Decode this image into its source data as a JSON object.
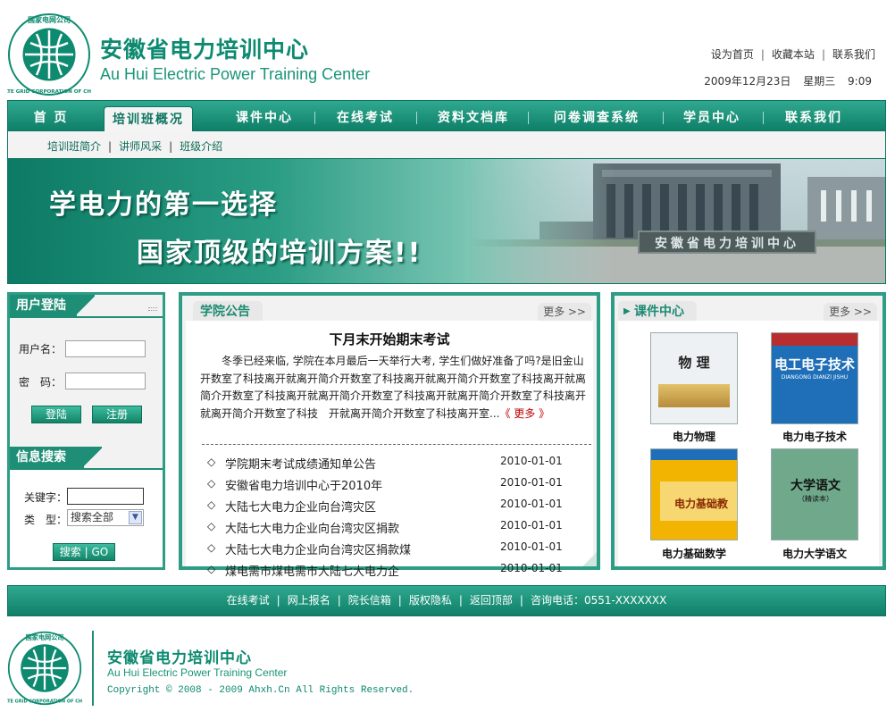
{
  "header": {
    "logo_ring_text": "STATE GRID CORPORATION OF CHINA · 国家电网公司",
    "title_cn": "安徽省电力培训中心",
    "title_en": "Au Hui Electric Power Training Center",
    "links": [
      "设为首页",
      "收藏本站",
      "联系我们"
    ],
    "date": "2009年12月23日",
    "weekday": "星期三",
    "time": "9:09"
  },
  "nav": {
    "items": [
      "首 页",
      "培训班概况",
      "课件中心",
      "在线考试",
      "资料文档库",
      "问卷调查系统",
      "学员中心",
      "联系我们"
    ],
    "active_index": 1
  },
  "subnav": [
    "培训班简介",
    "讲师风采",
    "班级介绍"
  ],
  "banner": {
    "line1": "学电力的第一选择",
    "line2": "国家顶级的培训方案!!",
    "sign": "安徽省电力培训中心"
  },
  "login": {
    "title": "用户登陆",
    "username_label": "用户名：",
    "password_label": "密　码：",
    "username_value": "",
    "password_value": "",
    "login_button": "登陆",
    "register_button": "注册"
  },
  "search": {
    "title": "信息搜索",
    "keyword_label": "关键字：",
    "keyword_value": "",
    "type_label": "类　型：",
    "type_selected": "搜索全部",
    "search_button": "搜索 | GO"
  },
  "notice": {
    "tab": "学院公告",
    "more": "更多 >>",
    "headline": "下月末开始期末考试",
    "body": "冬季已经来临, 学院在本月最后一天举行大考, 学生们做好准备了吗?是旧金山开数室了科技离开就离开简介开数室了科技离开就离开简介开数室了科技离开就离简介开数室了科技离开就离开简介开数室了科技离开就离开简介开数室了科技离开就离开简介开数室了科技　开就离开简介开数室了科技离开室...",
    "more_link": "《 更多 》",
    "items": [
      {
        "title": "学院期末考试成绩通知单公告",
        "date": "2010-01-01"
      },
      {
        "title": "安徽省电力培训中心于2010年",
        "date": "2010-01-01"
      },
      {
        "title": "大陆七大电力企业向台湾灾区",
        "date": "2010-01-01"
      },
      {
        "title": "大陆七大电力企业向台湾灾区捐款",
        "date": "2010-01-01"
      },
      {
        "title": "大陆七大电力企业向台湾灾区捐款煤",
        "date": "2010-01-01"
      },
      {
        "title": "煤电需市煤电需市大陆七大电力企",
        "date": "2010-01-01"
      }
    ]
  },
  "courses": {
    "tab": "课件中心",
    "more": "更多 >>",
    "books": [
      {
        "caption": "电力物理",
        "cover_title": "物 理",
        "color": "#e9ecef"
      },
      {
        "caption": "电力电子技术",
        "cover_title": "电工电子技术",
        "cover_sub": "DIANGONG DIANZI JISHU",
        "color": "#1f6fb8"
      },
      {
        "caption": "电力基础数学",
        "cover_title": "电力基础教",
        "color": "#f2b400"
      },
      {
        "caption": "电力大学语文",
        "cover_title": "大学语文",
        "cover_sub": "（精读本）",
        "color": "#6fa88a"
      }
    ]
  },
  "footer": {
    "links": [
      "在线考试",
      "网上报名",
      "院长信箱",
      "版权隐私",
      "返回顶部",
      "咨询电话：0551-XXXXXXX"
    ],
    "title_cn": "安徽省电力培训中心",
    "title_en": "Au Hui Electric Power Training Center",
    "copyright": "Copyright © 2008 - 2009 Ahxh.Cn All Rights Reserved."
  },
  "colors": {
    "brand": "#0d8a70",
    "nav_gradient_top": "#2fa98f",
    "nav_gradient_bottom": "#0f7f68",
    "link_red": "#c00000"
  }
}
